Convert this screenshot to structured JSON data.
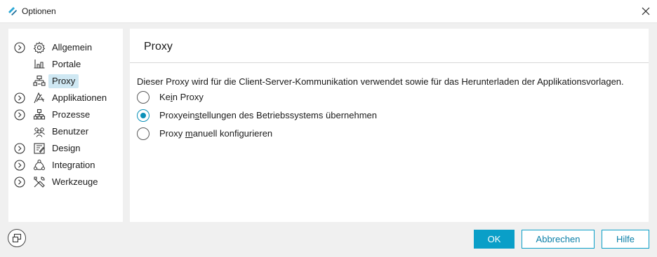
{
  "window": {
    "title": "Optionen"
  },
  "sidebar": {
    "items": [
      {
        "label": "Allgemein",
        "icon": "gear-icon",
        "expandable": true
      },
      {
        "label": "Portale",
        "icon": "portal-icon",
        "expandable": false
      },
      {
        "label": "Proxy",
        "icon": "proxy-network-icon",
        "expandable": false,
        "selected": true
      },
      {
        "label": "Applikationen",
        "icon": "applications-icon",
        "expandable": true
      },
      {
        "label": "Prozesse",
        "icon": "process-icon",
        "expandable": true
      },
      {
        "label": "Benutzer",
        "icon": "users-icon",
        "expandable": false
      },
      {
        "label": "Design",
        "icon": "design-icon",
        "expandable": true
      },
      {
        "label": "Integration",
        "icon": "integration-icon",
        "expandable": true
      },
      {
        "label": "Werkzeuge",
        "icon": "tools-icon",
        "expandable": true
      }
    ]
  },
  "main": {
    "title": "Proxy",
    "description": "Dieser Proxy wird für die Client-Server-Kommunikation verwendet sowie für das Herunterladen der Applikationsvorlagen.",
    "options": [
      {
        "pre": "Ke",
        "mnemonic": "i",
        "post": "n Proxy",
        "checked": false
      },
      {
        "pre": "Proxyein",
        "mnemonic": "s",
        "post": "tellungen des Betriebssystems übernehmen",
        "checked": true
      },
      {
        "pre": "Proxy ",
        "mnemonic": "m",
        "post": "anuell konfigurieren",
        "checked": false
      }
    ]
  },
  "footer": {
    "ok_label": "OK",
    "cancel_label": "Abbrechen",
    "help_label": "Hilfe"
  },
  "colors": {
    "accent": "#0a9fc8",
    "selection": "#cfe8f3"
  }
}
